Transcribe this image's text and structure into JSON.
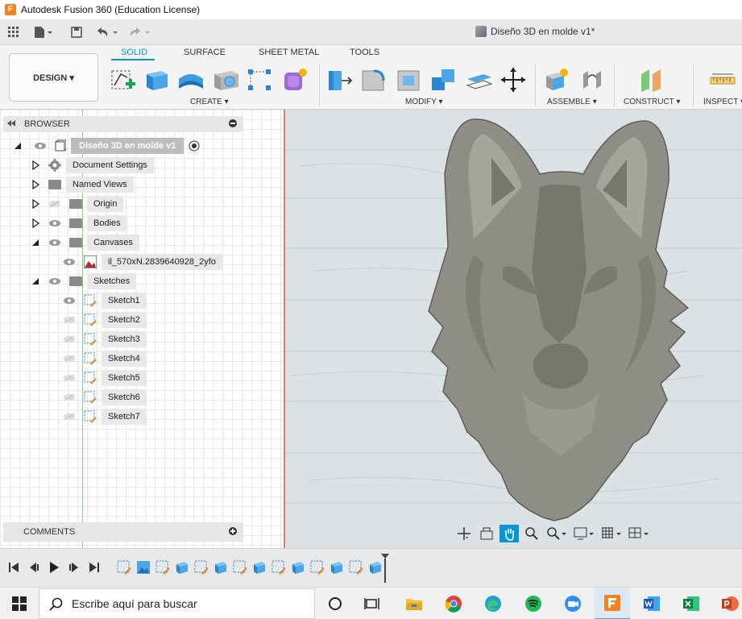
{
  "window": {
    "title": "Autodesk Fusion 360 (Education License)",
    "app_logo": "F"
  },
  "quick_access": {
    "document_title": "Diseño 3D en molde v1*",
    "icons": [
      "grid-menu-icon",
      "file-icon",
      "save-icon",
      "undo-icon",
      "redo-icon"
    ]
  },
  "ribbon": {
    "workspace": "DESIGN ▾",
    "tabs": [
      {
        "label": "SOLID",
        "active": true
      },
      {
        "label": "SURFACE",
        "active": false
      },
      {
        "label": "SHEET METAL",
        "active": false
      },
      {
        "label": "TOOLS",
        "active": false
      }
    ],
    "groups": {
      "create": "CREATE ▾",
      "modify": "MODIFY ▾",
      "assemble": "ASSEMBLE ▾",
      "construct": "CONSTRUCT ▾",
      "inspect": "INSPECT ▾"
    },
    "accent": "#0696d7"
  },
  "browser": {
    "title": "BROWSER",
    "root": "Diseño 3D en molde v1",
    "items": [
      {
        "label": "Document Settings"
      },
      {
        "label": "Named Views"
      },
      {
        "label": "Origin"
      },
      {
        "label": "Bodies"
      },
      {
        "label": "Canvases"
      },
      {
        "label": "il_570xN.2839640928_2yfo"
      },
      {
        "label": "Sketches"
      }
    ],
    "sketches": [
      "Sketch1",
      "Sketch2",
      "Sketch3",
      "Sketch4",
      "Sketch5",
      "Sketch6",
      "Sketch7"
    ]
  },
  "comments": {
    "title": "COMMENTS"
  },
  "taskbar": {
    "search_placeholder": "Escribe aquí para buscar",
    "apps": [
      "task-view-icon",
      "file-explorer-icon",
      "chrome-icon",
      "edge-icon",
      "spotify-icon",
      "zoom-icon",
      "fusion360-icon",
      "word-icon",
      "excel-icon",
      "powerpoint-icon"
    ]
  }
}
